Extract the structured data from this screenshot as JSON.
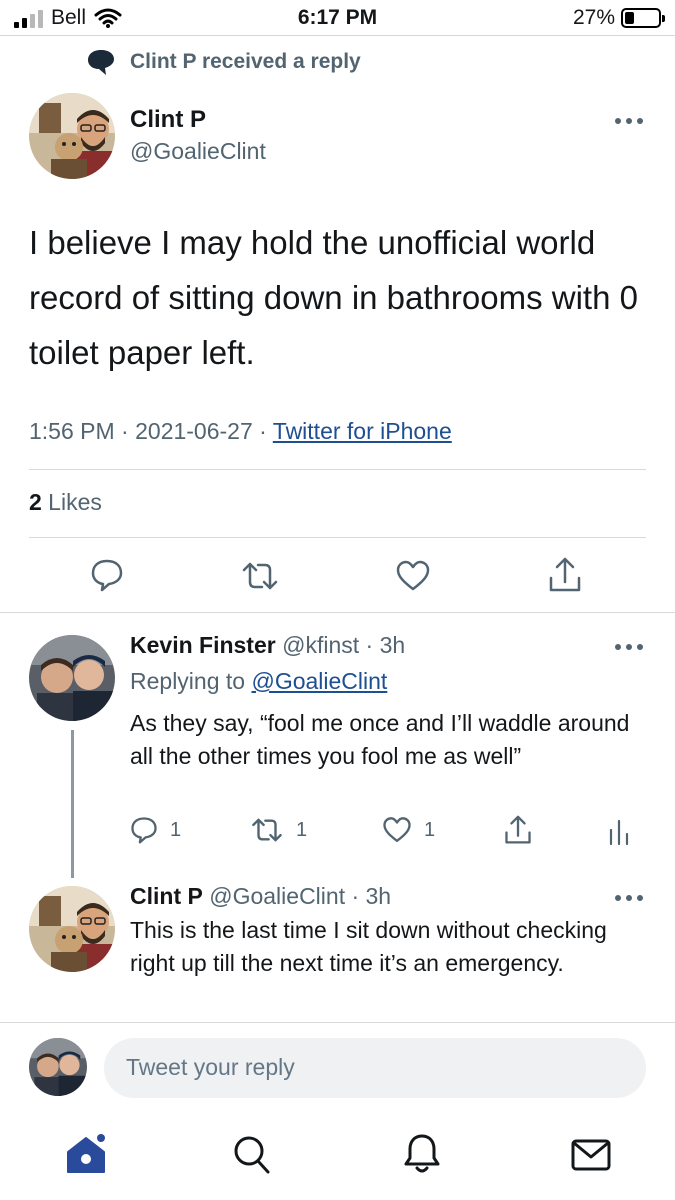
{
  "status_bar": {
    "carrier": "Bell",
    "time": "6:17 PM",
    "battery": "27%",
    "battery_level": 0.27
  },
  "context_line": "Clint P received a reply",
  "main_tweet": {
    "name": "Clint P",
    "handle": "@GoalieClint",
    "text": "I believe I may hold the unofficial world record of sitting down in bathrooms with 0 toilet paper left.",
    "time": "1:56 PM",
    "sep1": " · ",
    "date": "2021-06-27",
    "sep2": " · ",
    "source": "Twitter for iPhone",
    "likes_count": "2",
    "likes_label": " Likes"
  },
  "reply1": {
    "name": "Kevin Finster",
    "handle": " @kfinst · 3h",
    "replying_prefix": "Replying to ",
    "replying_to": "@GoalieClint",
    "text": "As they say, “fool me once and I’ll waddle around all the other times you fool me as well”",
    "reply_count": "1",
    "retweet_count": "1",
    "like_count": "1"
  },
  "reply2": {
    "name": "Clint P",
    "handle": " @GoalieClint · 3h",
    "text": "This is the last time I sit down without checking right up till the next time it’s an emergency."
  },
  "compose": {
    "placeholder": "Tweet your reply"
  },
  "colors": {
    "link": "#1d4f91",
    "muted": "#536471",
    "home": "#2a4a9b"
  },
  "icons": [
    "speech-bubble-icon",
    "reply-icon",
    "retweet-icon",
    "heart-icon",
    "share-icon",
    "analytics-icon",
    "home-icon",
    "search-icon",
    "bell-icon",
    "mail-icon"
  ]
}
